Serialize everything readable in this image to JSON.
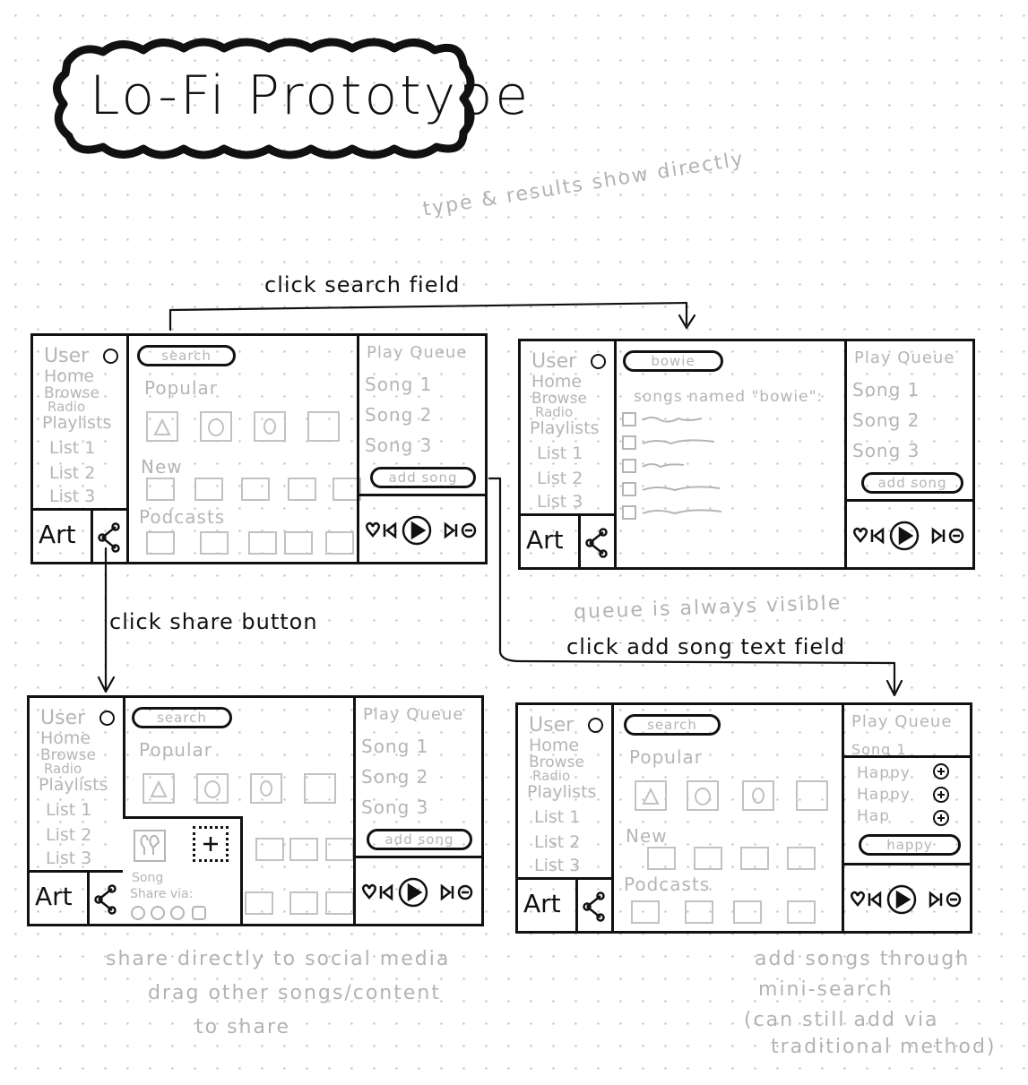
{
  "title": "Lo-Fi Prototype",
  "flow_labels": {
    "search": "click search field",
    "share": "click share button",
    "add_song": "click add song text field"
  },
  "notes": {
    "search": "type & results show directly",
    "queue": "queue is always visible",
    "share_line1": "share directly to social media",
    "share_line2": "drag other songs/content",
    "share_line3": "to share",
    "add_line1": "add songs through",
    "add_line2": "mini-search",
    "add_line3": "(can still add via",
    "add_line4": "traditional method)"
  },
  "ui": {
    "user": "User",
    "nav": [
      "Home",
      "Browse",
      "Radio",
      "Playlists"
    ],
    "lists": [
      "List 1",
      "List 2",
      "List 3"
    ],
    "art": "Art",
    "search_placeholder": "search",
    "sections": {
      "popular": "Popular",
      "new": "New",
      "podcasts": "Podcasts"
    },
    "queue_title": "Play Queue",
    "queue_songs": [
      "Song 1",
      "Song 2",
      "Song 3"
    ],
    "add_song": "add song"
  },
  "screen2": {
    "search_value": "bowie",
    "results_label": "songs named \"bowie\":"
  },
  "screen3": {
    "share_song": "Song",
    "share_via": "Share via:"
  },
  "screen4": {
    "queue_song": "Song 1",
    "mini_results": [
      "Happy",
      "Happy",
      "Hap"
    ],
    "mini_search_value": "happy"
  }
}
